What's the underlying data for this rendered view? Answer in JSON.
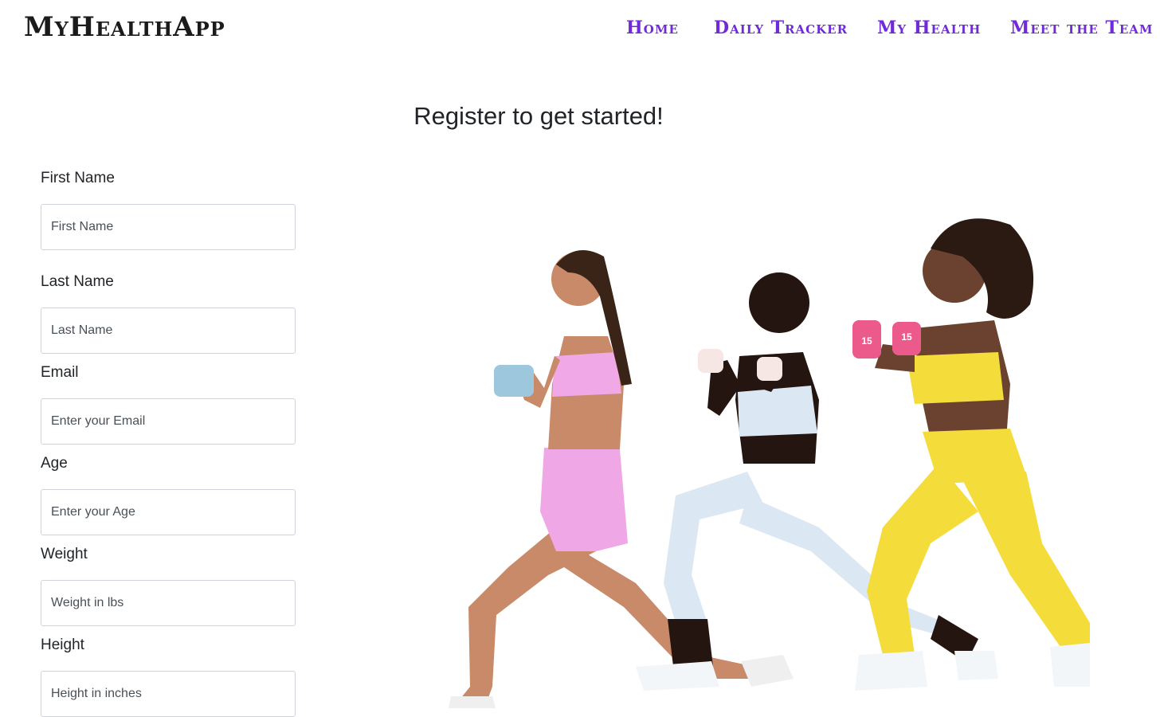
{
  "navbar": {
    "brand": "MyHealthApp",
    "links": [
      {
        "label": "Home"
      },
      {
        "label": "Daily Tracker"
      },
      {
        "label": "My Health"
      },
      {
        "label": "Meet the Team"
      }
    ]
  },
  "page": {
    "title": "Register to get started!"
  },
  "form": {
    "fields": [
      {
        "label": "First Name",
        "placeholder": "First Name",
        "value": ""
      },
      {
        "label": "Last Name",
        "placeholder": "Last Name",
        "value": ""
      },
      {
        "label": "Email",
        "placeholder": "Enter your Email",
        "value": ""
      },
      {
        "label": "Age",
        "placeholder": "Enter your Age",
        "value": ""
      },
      {
        "label": "Weight",
        "placeholder": "Weight in lbs",
        "value": ""
      },
      {
        "label": "Height",
        "placeholder": "Height in inches",
        "value": ""
      }
    ]
  },
  "hero": {
    "dumbbell_labels": [
      "15",
      "15"
    ]
  },
  "colors": {
    "nav_link": "#6f2bd8",
    "brand": "#1b1b1b",
    "outfit_pink": "#f2a6e6",
    "outfit_light_blue": "#dbe7f2",
    "outfit_yellow": "#f4dc3a",
    "dumbbell_blue": "#9cc7dc",
    "dumbbell_pink": "#ec5a8c"
  }
}
